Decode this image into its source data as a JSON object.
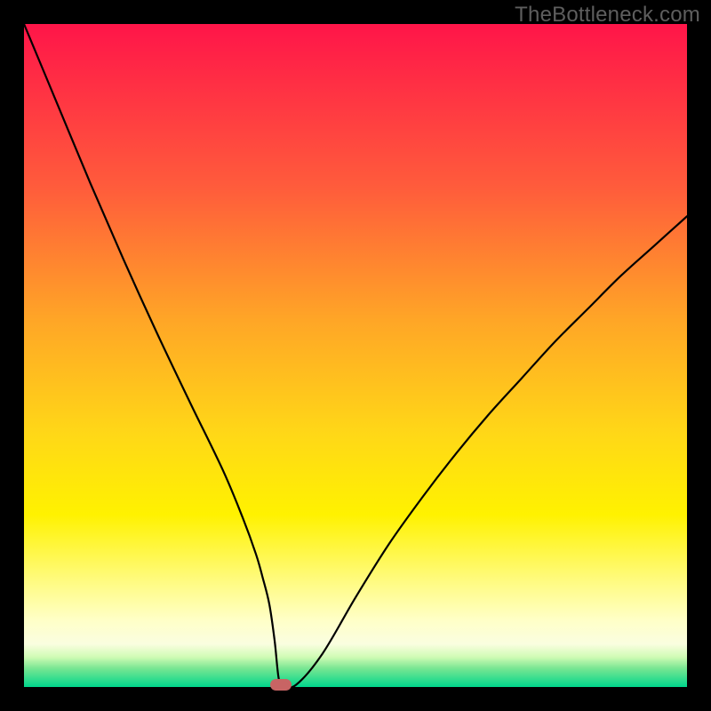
{
  "watermark": "TheBottleneck.com",
  "chart_data": {
    "type": "line",
    "title": "",
    "xlabel": "",
    "ylabel": "",
    "xlim": [
      0,
      100
    ],
    "ylim": [
      0,
      100
    ],
    "x": [
      0,
      5,
      10,
      15,
      20,
      25,
      30,
      33,
      35,
      36,
      37,
      37.8,
      38.4,
      39,
      41,
      45,
      50,
      55,
      60,
      65,
      70,
      75,
      80,
      85,
      90,
      95,
      100
    ],
    "values": [
      100,
      88,
      76,
      64.5,
      53.5,
      43,
      32.7,
      25.5,
      20,
      16.5,
      12.5,
      7,
      1.4,
      0.3,
      0.3,
      5,
      13.5,
      21.5,
      28.5,
      35,
      41,
      46.5,
      52,
      57,
      62,
      66.5,
      71
    ],
    "marker": {
      "x": 38.7,
      "y": 0.3,
      "color": "#c86464"
    },
    "gradient_stops": [
      {
        "pos": 0,
        "color": "#ff1549"
      },
      {
        "pos": 25,
        "color": "#ff5d3b"
      },
      {
        "pos": 45,
        "color": "#ffa726"
      },
      {
        "pos": 62,
        "color": "#ffd817"
      },
      {
        "pos": 74,
        "color": "#fff200"
      },
      {
        "pos": 84,
        "color": "#fffb80"
      },
      {
        "pos": 90,
        "color": "#ffffc8"
      },
      {
        "pos": 93.5,
        "color": "#fafee0"
      },
      {
        "pos": 95.5,
        "color": "#cffbb4"
      },
      {
        "pos": 97.2,
        "color": "#78e692"
      },
      {
        "pos": 100,
        "color": "#00d68c"
      }
    ]
  }
}
